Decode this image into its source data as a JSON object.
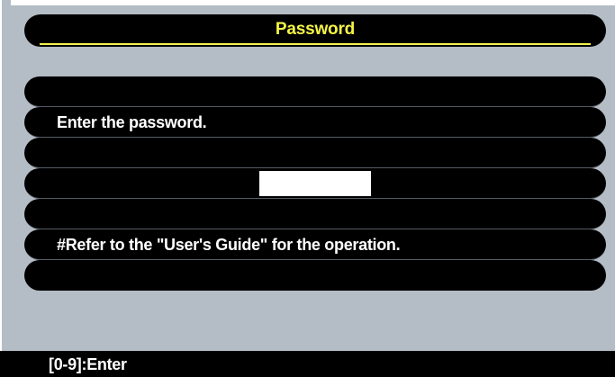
{
  "dialog": {
    "title": "Password",
    "lines": [
      "",
      "Enter the password.",
      "",
      "",
      "",
      "#Refer to the \"User's Guide\" for the operation.",
      ""
    ],
    "password_value": ""
  },
  "status_bar": {
    "hint": "[0-9]:Enter"
  },
  "colors": {
    "background": "#b4bcc5",
    "panel": "#000000",
    "title_text": "#f5f547",
    "body_text": "#ffffff"
  }
}
